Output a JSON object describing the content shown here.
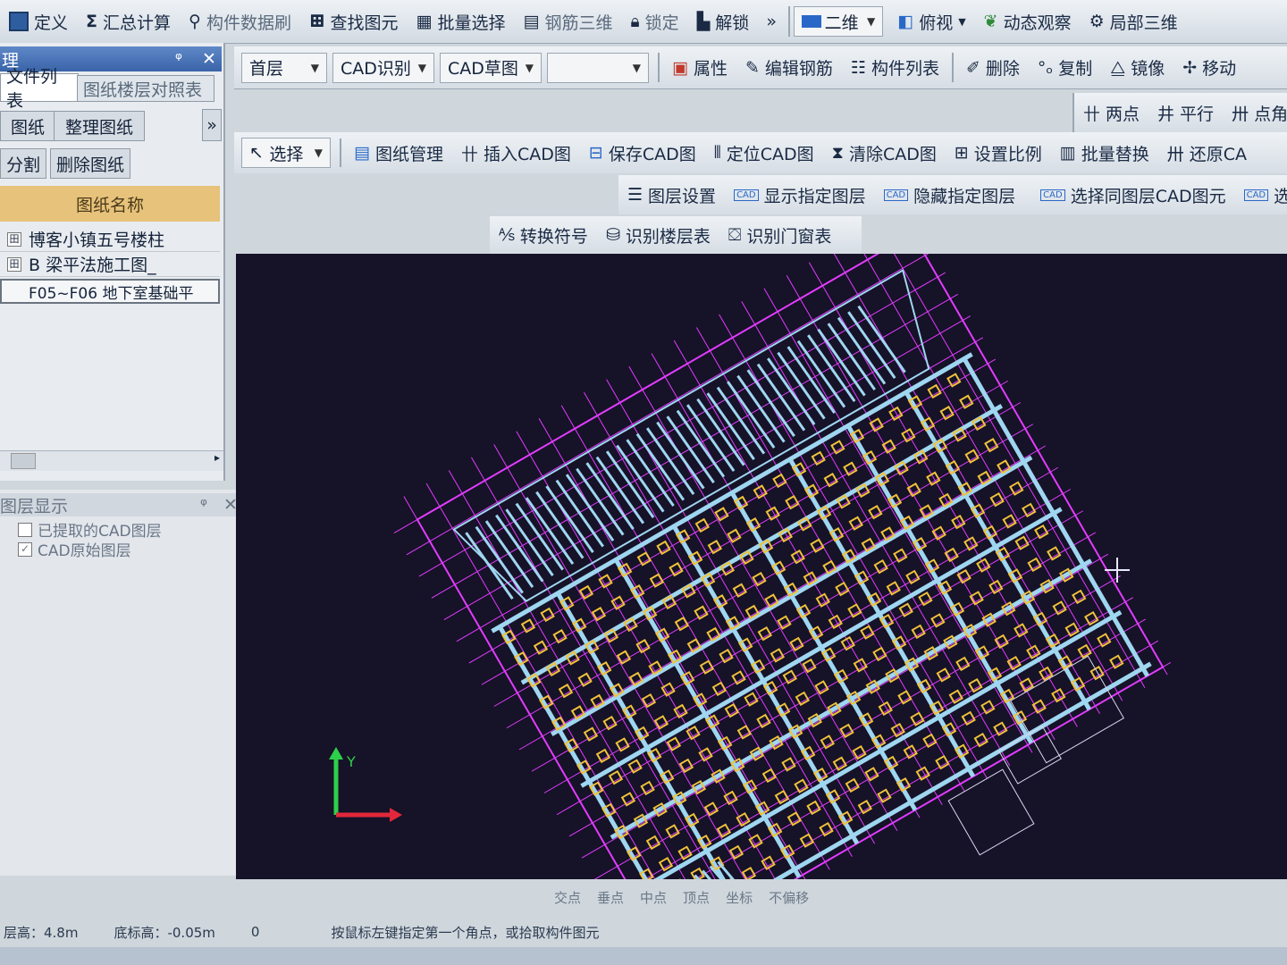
{
  "toolbar1": {
    "items": [
      {
        "label": "定义",
        "icon": "table-icon"
      },
      {
        "label": "汇总计算",
        "icon": "sigma-icon"
      },
      {
        "label": "构件数据刷",
        "icon": "brush-icon"
      },
      {
        "label": "查找图元",
        "icon": "binoculars-icon"
      },
      {
        "label": "批量选择",
        "icon": "grid-select-icon"
      },
      {
        "label": "钢筋三维",
        "icon": "rebar-3d-icon"
      },
      {
        "label": "锁定",
        "icon": "lock-icon"
      },
      {
        "label": "解锁",
        "icon": "unlock-icon"
      }
    ],
    "more": "»",
    "view_mode": "二维",
    "view_angle": "俯视",
    "dynamic": "动态观察",
    "local3d": "局部三维"
  },
  "toolbar2": {
    "floor": "首层",
    "mode": "CAD识别",
    "sub": "CAD草图",
    "empty": "",
    "items": [
      {
        "label": "属性",
        "icon": "property-icon"
      },
      {
        "label": "编辑钢筋",
        "icon": "edit-rebar-icon"
      },
      {
        "label": "构件列表",
        "icon": "list-icon"
      },
      {
        "label": "删除",
        "icon": "delete-icon"
      },
      {
        "label": "复制",
        "icon": "copy-icon"
      },
      {
        "label": "镜像",
        "icon": "mirror-icon"
      },
      {
        "label": "移动",
        "icon": "move-icon"
      }
    ]
  },
  "toolbar3": {
    "items": [
      {
        "label": "两点",
        "icon": "two-point-icon"
      },
      {
        "label": "平行",
        "icon": "parallel-icon"
      },
      {
        "label": "点角",
        "icon": "point-angle-icon"
      }
    ]
  },
  "toolbar4": {
    "select": "选择",
    "items": [
      {
        "label": "图纸管理",
        "icon": "drawing-manage-icon"
      },
      {
        "label": "插入CAD图",
        "icon": "insert-cad-icon"
      },
      {
        "label": "保存CAD图",
        "icon": "save-cad-icon"
      },
      {
        "label": "定位CAD图",
        "icon": "locate-cad-icon"
      },
      {
        "label": "清除CAD图",
        "icon": "clear-cad-icon"
      },
      {
        "label": "设置比例",
        "icon": "scale-icon"
      },
      {
        "label": "批量替换",
        "icon": "batch-replace-icon"
      },
      {
        "label": "还原CA",
        "icon": "restore-cad-icon"
      }
    ]
  },
  "toolbar5": {
    "items": [
      {
        "label": "图层设置",
        "icon": "layer-settings-icon"
      },
      {
        "label": "显示指定图层",
        "icon": "cad-show-layer-icon"
      },
      {
        "label": "隐藏指定图层",
        "icon": "cad-hide-layer-icon"
      },
      {
        "label": "选择同图层CAD图元",
        "icon": "select-same-layer-icon"
      },
      {
        "label": "选",
        "icon": "select-cad-icon"
      }
    ]
  },
  "toolbar6": {
    "items": [
      {
        "label": "转换符号",
        "icon": "convert-symbol-icon"
      },
      {
        "label": "识别楼层表",
        "icon": "recognize-floor-icon"
      },
      {
        "label": "识别门窗表",
        "icon": "recognize-door-icon"
      }
    ]
  },
  "left_panel": {
    "title": "理",
    "pin": "ᵠ",
    "close": "✕",
    "tabs": [
      "文件列表",
      "图纸楼层对照表"
    ],
    "buttons": [
      "图纸",
      "整理图纸",
      "分割",
      "删除图纸"
    ],
    "expand": "»",
    "column_header": "图纸名称",
    "rows": [
      {
        "expander": "田",
        "name": "博客小镇五号楼柱"
      },
      {
        "expander": "田",
        "name": "B 梁平法施工图_"
      },
      {
        "expander": "",
        "name": "F05~F06 地下室基础平"
      }
    ]
  },
  "layer_panel": {
    "title": "图层显示",
    "pin": "ᵠ",
    "close": "✕",
    "items": [
      {
        "label": "已提取的CAD图层",
        "checked": false
      },
      {
        "label": "CAD原始图层",
        "checked": true
      }
    ]
  },
  "canvas": {
    "axis_y": "Y"
  },
  "snap_bar": {
    "items": [
      "交点",
      "垂点",
      "中点",
      "顶点",
      "坐标",
      "不偏移"
    ]
  },
  "status_bar": {
    "floor_height": "层高：4.8m",
    "base_height": "底标高：-0.05m",
    "count": "0",
    "hint": "按鼠标左键指定第一个角点，或拾取构件图元"
  },
  "colors": {
    "canvas_bg": "#161228",
    "magenta": "#e23cff",
    "cyan": "#9fd6f0",
    "yellow": "#f0c23a"
  }
}
